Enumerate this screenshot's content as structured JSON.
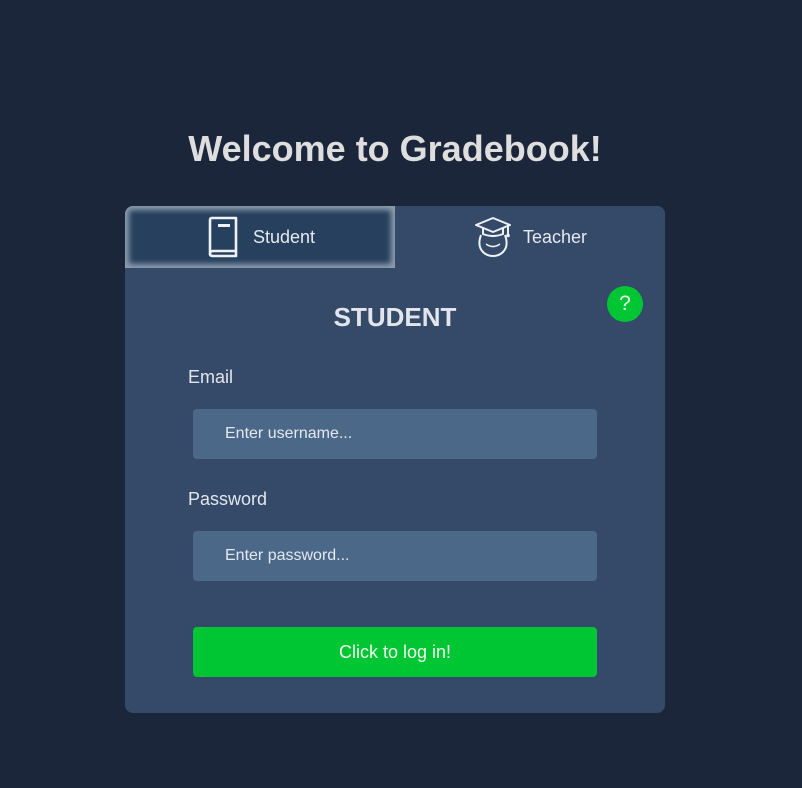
{
  "page": {
    "title": "Welcome to Gradebook!"
  },
  "tabs": [
    {
      "label": "Student",
      "icon": "book-icon",
      "active": true
    },
    {
      "label": "Teacher",
      "icon": "graduate-icon",
      "active": false
    }
  ],
  "form": {
    "heading": "STUDENT",
    "help_symbol": "?",
    "email_label": "Email",
    "email_placeholder": "Enter username...",
    "email_value": "",
    "password_label": "Password",
    "password_placeholder": "Enter password...",
    "password_value": "",
    "submit_label": "Click to log in!"
  },
  "colors": {
    "background": "#1c263a",
    "card": "#344a68",
    "active_tab": "#26405e",
    "input": "#4c6889",
    "accent": "#00c634"
  }
}
